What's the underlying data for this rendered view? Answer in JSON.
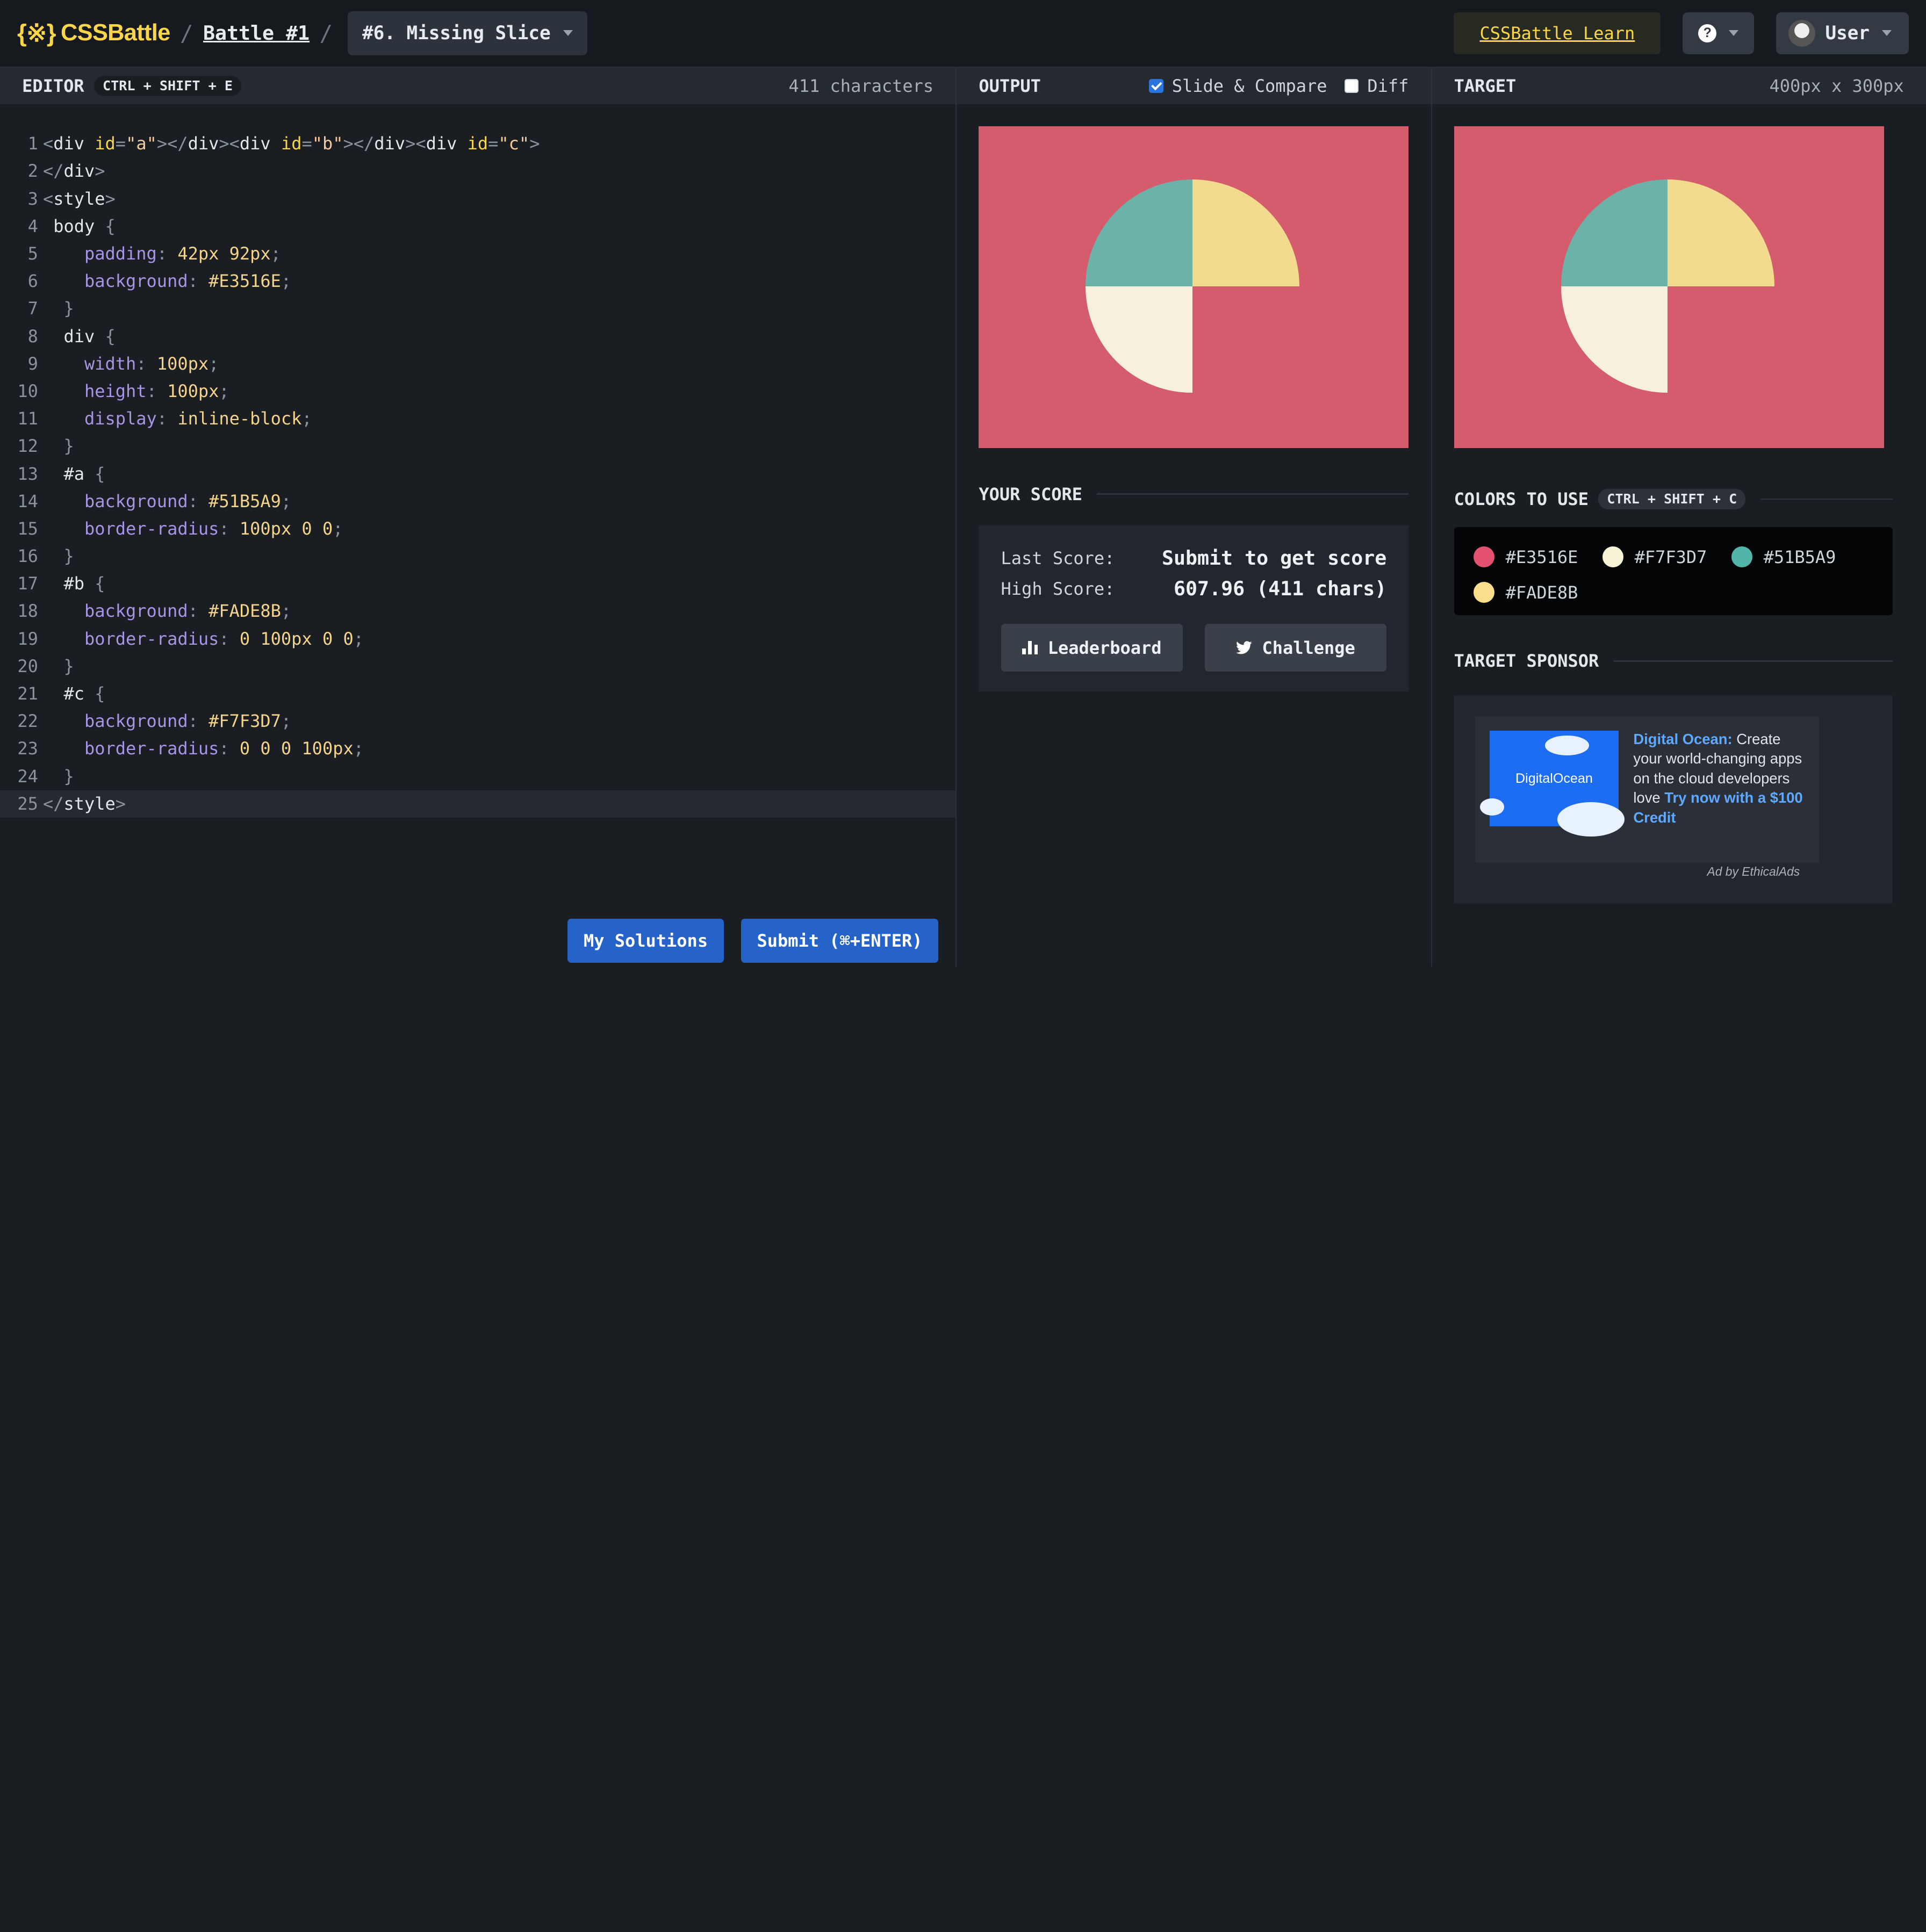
{
  "header": {
    "logo_text": "CSSBattle",
    "logo_mark": "{※}",
    "breadcrumb_sep": "/",
    "battle_link": "Battle #1",
    "target_select": "#6. Missing Slice",
    "learn_label": "CSSBattle Learn",
    "help_icon": "?",
    "user_label": "User"
  },
  "editor": {
    "title": "EDITOR",
    "shortcut": "CTRL + SHIFT + E",
    "char_count": "411 characters",
    "lines": [
      {
        "n": "1",
        "html": "<span class='t-br'>&lt;</span>div <span class='t-attr'>id</span><span class='t-br'>=</span><span class='t-str'>\"a\"</span><span class='t-br'>&gt;&lt;/</span>div<span class='t-br'>&gt;&lt;</span>div <span class='t-attr'>id</span><span class='t-br'>=</span><span class='t-str'>\"b\"</span><span class='t-br'>&gt;&lt;/</span>div<span class='t-br'>&gt;&lt;</span>div <span class='t-attr'>id</span><span class='t-br'>=</span><span class='t-str'>\"c\"</span><span class='t-br'>&gt;</span>"
      },
      {
        "n": "2",
        "html": "<span class='t-br'>&lt;/</span>div<span class='t-br'>&gt;</span>"
      },
      {
        "n": "3",
        "html": "<span class='t-br'>&lt;</span>style<span class='t-br'>&gt;</span>"
      },
      {
        "n": "4",
        "html": " body <span class='t-punc'>{</span>"
      },
      {
        "n": "5",
        "html": "    <span class='t-prop'>padding</span><span class='t-punc'>:</span> <span class='t-val'>42px 92px</span><span class='t-punc'>;</span>"
      },
      {
        "n": "6",
        "html": "    <span class='t-prop'>background</span><span class='t-punc'>:</span> <span class='t-val'>#E3516E</span><span class='t-punc'>;</span>"
      },
      {
        "n": "7",
        "html": "  <span class='t-punc'>}</span>"
      },
      {
        "n": "8",
        "html": "  div <span class='t-punc'>{</span>"
      },
      {
        "n": "9",
        "html": "    <span class='t-prop'>width</span><span class='t-punc'>:</span> <span class='t-val'>100px</span><span class='t-punc'>;</span>"
      },
      {
        "n": "10",
        "html": "    <span class='t-prop'>height</span><span class='t-punc'>:</span> <span class='t-val'>100px</span><span class='t-punc'>;</span>"
      },
      {
        "n": "11",
        "html": "    <span class='t-prop'>display</span><span class='t-punc'>:</span> <span class='t-val'>inline-block</span><span class='t-punc'>;</span>"
      },
      {
        "n": "12",
        "html": "  <span class='t-punc'>}</span>"
      },
      {
        "n": "13",
        "html": "  #a <span class='t-punc'>{</span>"
      },
      {
        "n": "14",
        "html": "    <span class='t-prop'>background</span><span class='t-punc'>:</span> <span class='t-val'>#51B5A9</span><span class='t-punc'>;</span>"
      },
      {
        "n": "15",
        "html": "    <span class='t-prop'>border-radius</span><span class='t-punc'>:</span> <span class='t-val'>100px 0 0</span><span class='t-punc'>;</span>"
      },
      {
        "n": "16",
        "html": "  <span class='t-punc'>}</span>"
      },
      {
        "n": "17",
        "html": "  #b <span class='t-punc'>{</span>"
      },
      {
        "n": "18",
        "html": "    <span class='t-prop'>background</span><span class='t-punc'>:</span> <span class='t-val'>#FADE8B</span><span class='t-punc'>;</span>"
      },
      {
        "n": "19",
        "html": "    <span class='t-prop'>border-radius</span><span class='t-punc'>:</span> <span class='t-val'>0 100px 0 0</span><span class='t-punc'>;</span>"
      },
      {
        "n": "20",
        "html": "  <span class='t-punc'>}</span>"
      },
      {
        "n": "21",
        "html": "  #c <span class='t-punc'>{</span>"
      },
      {
        "n": "22",
        "html": "    <span class='t-prop'>background</span><span class='t-punc'>:</span> <span class='t-val'>#F7F3D7</span><span class='t-punc'>;</span>"
      },
      {
        "n": "23",
        "html": "    <span class='t-prop'>border-radius</span><span class='t-punc'>:</span> <span class='t-val'>0 0 0 100px</span><span class='t-punc'>;</span>"
      },
      {
        "n": "24",
        "html": "  <span class='t-punc'>}</span>"
      },
      {
        "n": "25",
        "html": "<span class='t-br'>&lt;/</span>style<span class='t-br'>&gt;</span>"
      }
    ],
    "my_solutions_label": "My Solutions",
    "submit_label": "Submit (⌘+ENTER)"
  },
  "output": {
    "title": "OUTPUT",
    "slide_compare_label": "Slide & Compare",
    "slide_compare_checked": true,
    "diff_label": "Diff",
    "diff_checked": false
  },
  "score": {
    "title": "YOUR SCORE",
    "last_label": "Last Score:",
    "last_value": "Submit to get score",
    "high_label": "High Score:",
    "high_value": "607.96 (411 chars)",
    "leaderboard_label": "Leaderboard",
    "challenge_label": "Challenge"
  },
  "target": {
    "title": "TARGET",
    "size": "400px x 300px"
  },
  "colors": {
    "title": "COLORS TO USE",
    "shortcut": "CTRL + SHIFT + C",
    "list": [
      {
        "hex": "#E3516E",
        "label": "#E3516E"
      },
      {
        "hex": "#F7F3D7",
        "label": "#F7F3D7"
      },
      {
        "hex": "#51B5A9",
        "label": "#51B5A9"
      },
      {
        "hex": "#FADE8B",
        "label": "#FADE8B"
      }
    ]
  },
  "sponsor": {
    "title": "TARGET SPONSOR",
    "image_brand": "DigitalOcean",
    "brand": "Digital Ocean:",
    "text": "Create your world-changing apps on the cloud developers love",
    "cta": "Try now with a $100 Credit",
    "ad_by": "Ad by EthicalAds"
  }
}
